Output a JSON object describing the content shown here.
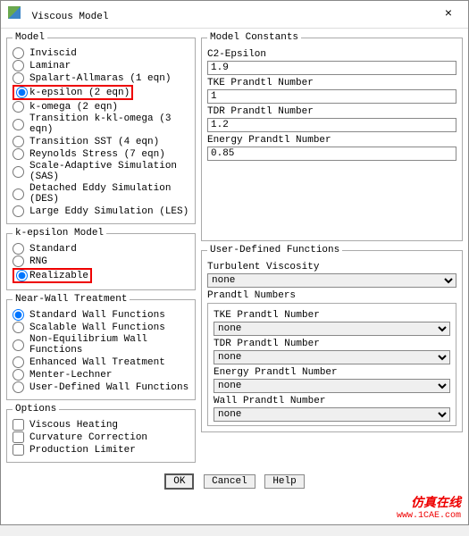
{
  "window": {
    "title": "Viscous Model",
    "close": "×"
  },
  "model": {
    "legend": "Model",
    "items": [
      {
        "label": "Inviscid"
      },
      {
        "label": "Laminar"
      },
      {
        "label": "Spalart-Allmaras (1 eqn)"
      },
      {
        "label": "k-epsilon (2 eqn)",
        "selected": true,
        "highlight": true
      },
      {
        "label": "k-omega (2 eqn)"
      },
      {
        "label": "Transition k-kl-omega (3 eqn)"
      },
      {
        "label": "Transition SST (4 eqn)"
      },
      {
        "label": "Reynolds Stress (7 eqn)"
      },
      {
        "label": "Scale-Adaptive Simulation (SAS)"
      },
      {
        "label": "Detached Eddy Simulation (DES)"
      },
      {
        "label": "Large Eddy Simulation (LES)"
      }
    ]
  },
  "ke_model": {
    "legend": "k-epsilon Model",
    "items": [
      {
        "label": "Standard"
      },
      {
        "label": "RNG"
      },
      {
        "label": "Realizable",
        "selected": true,
        "highlight": true
      }
    ]
  },
  "near_wall": {
    "legend": "Near-Wall Treatment",
    "items": [
      {
        "label": "Standard Wall Functions",
        "selected": true
      },
      {
        "label": "Scalable Wall Functions"
      },
      {
        "label": "Non-Equilibrium Wall Functions"
      },
      {
        "label": "Enhanced Wall Treatment"
      },
      {
        "label": "Menter-Lechner"
      },
      {
        "label": "User-Defined Wall Functions"
      }
    ]
  },
  "options": {
    "legend": "Options",
    "items": [
      {
        "label": "Viscous Heating"
      },
      {
        "label": "Curvature Correction"
      },
      {
        "label": "Production Limiter"
      }
    ]
  },
  "constants": {
    "legend": "Model Constants",
    "fields": [
      {
        "label": "C2-Epsilon",
        "value": "1.9"
      },
      {
        "label": "TKE Prandtl Number",
        "value": "1"
      },
      {
        "label": "TDR Prandtl Number",
        "value": "1.2"
      },
      {
        "label": "Energy Prandtl Number",
        "value": "0.85"
      }
    ]
  },
  "udf": {
    "legend": "User-Defined Functions",
    "turb_visc_label": "Turbulent Viscosity",
    "turb_visc_value": "none",
    "prandtl_legend": "Prandtl Numbers",
    "prandtl": [
      {
        "label": "TKE Prandtl Number",
        "value": "none"
      },
      {
        "label": "TDR Prandtl Number",
        "value": "none"
      },
      {
        "label": "Energy Prandtl Number",
        "value": "none"
      },
      {
        "label": "Wall Prandtl Number",
        "value": "none"
      }
    ]
  },
  "buttons": {
    "ok": "OK",
    "cancel": "Cancel",
    "help": "Help"
  },
  "footer": {
    "brand": "仿真在线",
    "url": "www.1CAE.com"
  }
}
